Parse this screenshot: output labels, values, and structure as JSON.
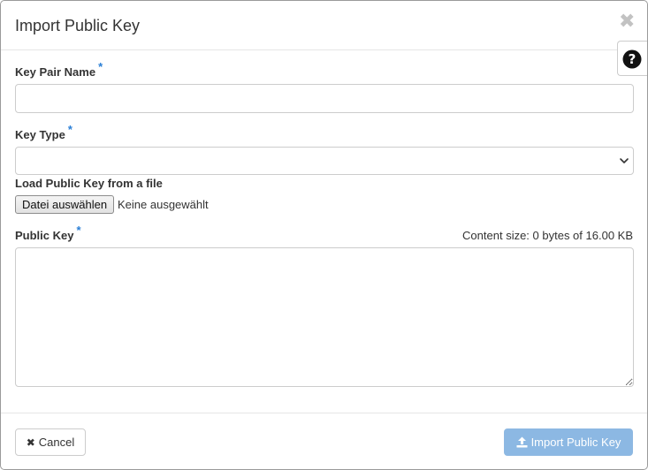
{
  "dialog": {
    "title": "Import Public Key",
    "close_icon": "close-icon",
    "help_icon": "question-circle-icon"
  },
  "form": {
    "key_pair_name": {
      "label": "Key Pair Name",
      "required_marker": "*",
      "value": "",
      "placeholder": ""
    },
    "key_type": {
      "label": "Key Type",
      "required_marker": "*",
      "selected": ""
    },
    "load_file": {
      "label": "Load Public Key from a file",
      "button_label": "Datei auswählen",
      "status": "Keine ausgewählt"
    },
    "public_key": {
      "label": "Public Key",
      "required_marker": "*",
      "content_size": "Content size: 0 bytes of 16.00 KB",
      "value": ""
    }
  },
  "footer": {
    "cancel_label": "Cancel",
    "cancel_icon": "times-icon",
    "import_label": "Import Public Key",
    "import_icon": "upload-icon"
  },
  "colors": {
    "required_marker": "#2a7fd6",
    "primary_button_disabled": "#8cb8e3",
    "close_icon": "#c2c2c2"
  }
}
